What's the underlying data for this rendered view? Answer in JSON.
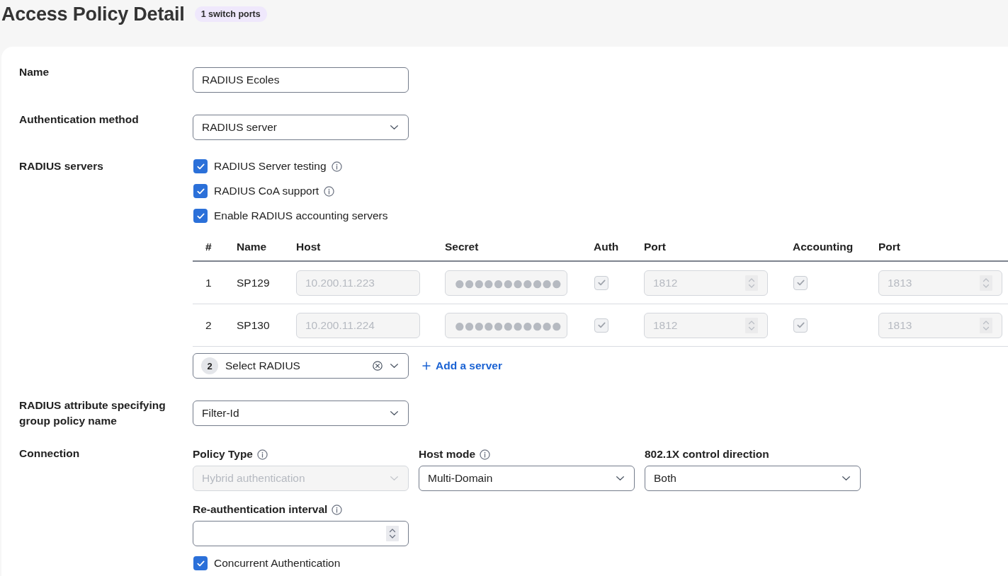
{
  "header": {
    "title": "Access Policy Detail",
    "badge": "1 switch ports"
  },
  "name": {
    "label": "Name",
    "value": "RADIUS Ecoles"
  },
  "authentication_method": {
    "label": "Authentication method",
    "value": "RADIUS server"
  },
  "radius_servers": {
    "label": "RADIUS servers",
    "options": [
      {
        "label": "RADIUS Server testing",
        "checked": true,
        "info": true
      },
      {
        "label": "RADIUS CoA support",
        "checked": true,
        "info": true
      },
      {
        "label": "Enable RADIUS accounting servers",
        "checked": true,
        "info": false
      }
    ],
    "table": {
      "columns": [
        "#",
        "Name",
        "Host",
        "Secret",
        "Auth",
        "Port",
        "Accounting",
        "Port"
      ],
      "rows": [
        {
          "number": "1",
          "name": "SP129",
          "host": "10.200.11.223",
          "secret": "●●●●●●●●●●●",
          "auth": true,
          "auth_port": "1812",
          "accounting": true,
          "accounting_port": "1813",
          "disabled": true
        },
        {
          "number": "2",
          "name": "SP130",
          "host": "10.200.11.224",
          "secret": "●●●●●●●●●●●",
          "auth": true,
          "auth_port": "1812",
          "accounting": true,
          "accounting_port": "1813",
          "disabled": true
        }
      ]
    },
    "radius_select": {
      "count": "2",
      "label": "Select RADIUS"
    },
    "add_link": "Add a server"
  },
  "radius_attribute": {
    "label": "RADIUS attribute specifying group policy name",
    "value": "Filter-Id"
  },
  "connection": {
    "label": "Connection",
    "fields": [
      {
        "kind": "select",
        "label": "Policy Type",
        "info": true,
        "value": "Hybrid authentication",
        "disabled": true
      },
      {
        "kind": "select",
        "label": "Host mode",
        "info": true,
        "value": "Multi-Domain",
        "disabled": false
      },
      {
        "kind": "select",
        "label": "802.1X control direction",
        "info": false,
        "value": "Both",
        "disabled": false
      },
      {
        "kind": "number",
        "label": "Re-authentication interval",
        "info": true,
        "disabled": false
      }
    ],
    "options": [
      {
        "label": "Concurrent Authentication",
        "checked": true
      }
    ]
  }
}
